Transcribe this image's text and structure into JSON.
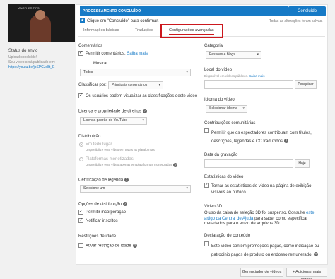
{
  "video": {
    "thumbnail_caption": "ANOTHER TIPS",
    "status_title": "Status do envio",
    "status_value": "Upload concluído!",
    "published_label": "Seu vídeo será publicado em:",
    "published_url": "https://youtu.be/jbSPCJo8t_E"
  },
  "header": {
    "progress_text": "PROCESSAMENTO CONCLUÍDO",
    "progress_percent": 100,
    "done_button": "Concluído",
    "hint_text": "Clique em \"Concluído\" para confirmar.",
    "saved_text": "Todas as alterações foram salvas."
  },
  "tabs": [
    {
      "label": "Informações básicas",
      "active": false
    },
    {
      "label": "Traduções",
      "active": false
    },
    {
      "label": "Configurações avançadas",
      "active": true
    }
  ],
  "left_col": {
    "comments": {
      "title": "Comentários",
      "allow_label": "Permitir comentários.",
      "allow_link": "Saiba mais",
      "allow_checked": true,
      "show_label": "Mostrar",
      "show_value": "Todos",
      "sort_label": "Classificar por:",
      "sort_value": "Principais comentários",
      "ratings_label": "Os usuários podem visualizar as classificações deste vídeo",
      "ratings_checked": true
    },
    "license": {
      "title": "Licença e propriedade de direitos",
      "value": "Licença padrão do YouTube"
    },
    "distribution": {
      "title": "Distribuição",
      "opt1_label": "Em todo lugar",
      "opt1_sub": "Disponibilize este vídeo em todas as plataformas",
      "opt2_label": "Plataformas monetizadas",
      "opt2_sub": "Disponibilize este vídeo apenas em plataformas monetizadas"
    },
    "caption_cert": {
      "title": "Certificação de legenda",
      "value": "Selecione um"
    },
    "dist_options": {
      "title": "Opções de distribuição",
      "embed_label": "Permitir incorporação",
      "embed_checked": true,
      "notify_label": "Notificar inscritos",
      "notify_checked": true
    },
    "age": {
      "title": "Restrições de idade",
      "label": "Ativar restrição de idade",
      "checked": false
    }
  },
  "right_col": {
    "category": {
      "title": "Categoria",
      "value": "Pessoas e blogs"
    },
    "location": {
      "title": "Local do vídeo",
      "sub": "Disponível em vídeos públicos.",
      "link": "Saiba mais",
      "placeholder": "",
      "search_button": "Pesquisar"
    },
    "language": {
      "title": "Idioma do vídeo",
      "value": "Selecionar idioma"
    },
    "contributions": {
      "title": "Contribuições comunitárias",
      "label": "Permitir que os espectadores contribuam com títulos, descrições, legendas e CC traduzidos",
      "checked": false
    },
    "recording": {
      "title": "Data da gravação",
      "today_button": "Hoje"
    },
    "stats": {
      "title": "Estatísticas do vídeo",
      "label": "Tornar as estatísticas de vídeo na página de exibição visíveis ao público",
      "checked": true
    },
    "video3d": {
      "title": "Vídeo 3D",
      "text": "O uso da caixa de seleção 3D foi suspenso. Consulte",
      "link": "este artigo da Central de Ajuda",
      "text2": "para saber como especificar metadados para o envio de arquivos 3D."
    },
    "declaration": {
      "title": "Declaração de conteúdo",
      "label": "Este vídeo contém promoções pagas, como indicação ou patrocínio pagos de produto ou endosso remunerado.",
      "checked": false
    }
  },
  "footer": {
    "manager_button": "Gerenciador de vídeos",
    "add_more_button": "+ Adicionar mais vídeos"
  },
  "colors": {
    "accent": "#167ac6",
    "highlight": "#cc181e"
  }
}
